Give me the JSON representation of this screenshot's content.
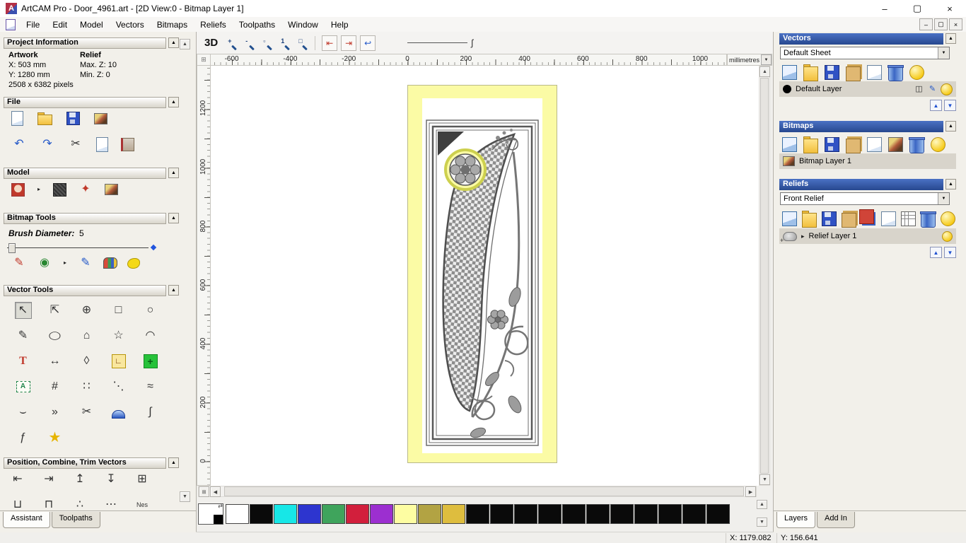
{
  "window": {
    "title": "ArtCAM Pro - Door_4961.art - [2D View:0 - Bitmap Layer 1]",
    "logo": "A",
    "controls": {
      "minimize": "–",
      "maximize": "▢",
      "close": "×"
    },
    "menu_items": [
      {
        "label": "File"
      },
      {
        "label": "Edit"
      },
      {
        "label": "Model"
      },
      {
        "label": "Vectors"
      },
      {
        "label": "Bitmaps"
      },
      {
        "label": "Reliefs"
      },
      {
        "label": "Toolpaths"
      },
      {
        "label": "Window"
      },
      {
        "label": "Help"
      }
    ]
  },
  "ui": {
    "collapse": "▲",
    "up": "▲",
    "down": "▼",
    "left": "◀",
    "right": "▶",
    "dropdown": "▼",
    "expander": "▸",
    "swap": "⇄",
    "corner": "⊞"
  },
  "toolbar": {
    "curve_glyph": "ʃ",
    "icons": [
      {
        "n": "view-3d",
        "g": "3D",
        "c": "btn-3d"
      },
      {
        "n": "zoom-in",
        "g": "+",
        "c": "shape-mag"
      },
      {
        "n": "zoom-out",
        "g": "-",
        "c": "shape-mag"
      },
      {
        "n": "zoom-window",
        "g": "▫",
        "c": "shape-mag"
      },
      {
        "n": "zoom-100",
        "g": "1",
        "c": "shape-mag"
      },
      {
        "n": "zoom-fit",
        "g": "□",
        "c": "shape-mag"
      },
      {
        "n": "separator",
        "c": "toolbar-sep",
        "x": false
      },
      {
        "n": "snapshot-left",
        "g": "⇤",
        "c": "boxed glyph-red"
      },
      {
        "n": "snapshot-right",
        "g": "⇥",
        "c": "boxed glyph-red"
      },
      {
        "n": "previous-view",
        "g": "↩",
        "c": "boxed glyph-blue"
      }
    ]
  },
  "rulers": {
    "horizontal_labels": [
      "-600",
      "-400",
      "-200",
      "0",
      "200",
      "400",
      "600",
      "800",
      "1000"
    ],
    "vertical_labels": [
      "1200",
      "1000",
      "800",
      "600",
      "400",
      "200",
      "0"
    ],
    "units": "millimetres"
  },
  "assistant": {
    "project_information": {
      "title": "Project Information",
      "artwork_heading": "Artwork",
      "relief_heading": "Relief",
      "artwork_x": "X: 503 mm",
      "artwork_y": "Y: 1280 mm",
      "relief_max_z": "Max. Z: 10",
      "relief_min_z": "Min. Z: 0",
      "pixels": "2508 x 6382 pixels"
    },
    "file_section_title": "File",
    "model_section_title": "Model",
    "bitmap_tools_title": "Bitmap Tools",
    "brush_diameter_label": "Brush Diameter:",
    "brush_diameter_value": "5",
    "vector_tools_title": "Vector Tools",
    "position_section_title": "Position, Combine, Trim Vectors",
    "file_row1": [
      {
        "n": "new-model",
        "c": "shape-page"
      },
      {
        "n": "open-model",
        "c": "shape-folder"
      },
      {
        "n": "save-model",
        "c": "shape-save"
      },
      {
        "n": "model-preview",
        "c": "shape-img"
      }
    ],
    "file_row2": [
      {
        "n": "undo",
        "g": "↶",
        "c": "glyph-blue"
      },
      {
        "n": "redo",
        "g": "↷",
        "c": "glyph-blue"
      },
      {
        "n": "cut",
        "g": "✂",
        "c": "glyph-dark"
      },
      {
        "n": "paste",
        "c": "shape-page"
      },
      {
        "n": "notes",
        "c": "shape-book"
      }
    ],
    "model_row": [
      {
        "n": "model-lighting",
        "c": "shape-face"
      },
      {
        "n": "flyout",
        "g": "▸",
        "c": "flyout",
        "x": false
      },
      {
        "n": "model-texture",
        "c": "shape-tex"
      },
      {
        "n": "model-stamp",
        "g": "✦",
        "c": "glyph-red"
      },
      {
        "n": "model-image",
        "c": "shape-img"
      }
    ],
    "bitmap_row": [
      {
        "n": "paint-brush",
        "g": "✎",
        "c": "glyph-red"
      },
      {
        "n": "flood-fill",
        "g": "◉",
        "c": "glyph-green"
      },
      {
        "n": "flyout",
        "g": "▸",
        "c": "flyout",
        "x": false
      },
      {
        "n": "paint-selective",
        "g": "✎",
        "c": "glyph-blue"
      },
      {
        "n": "colour-palette",
        "c": "shape-palette"
      },
      {
        "n": "magic-texture",
        "c": "shape-blob"
      }
    ],
    "vector_tools_icons": [
      {
        "n": "select-vectors",
        "g": "↖",
        "c": "pressed glyph-dark"
      },
      {
        "n": "transform-vectors",
        "g": "⇱",
        "c": "glyph-dark"
      },
      {
        "n": "move-vectors",
        "g": "⊕",
        "c": "glyph-dark"
      },
      {
        "n": "create-rectangle",
        "g": "□",
        "c": "glyph-dark"
      },
      {
        "n": "create-circle",
        "g": "○",
        "c": "glyph-dark"
      },
      {
        "n": "create-polyline",
        "g": "✎",
        "c": "glyph-dark"
      },
      {
        "n": "create-ellipse",
        "g": "◯",
        "c": "glyph-dark glyph-ellipse"
      },
      {
        "n": "create-polygon",
        "g": "⌂",
        "c": "glyph-dark"
      },
      {
        "n": "create-star",
        "g": "☆",
        "c": "glyph-dark"
      },
      {
        "n": "create-arc",
        "g": "◠",
        "c": "glyph-dark"
      },
      {
        "n": "create-text",
        "g": "T",
        "c": "glyph-text"
      },
      {
        "n": "measure",
        "g": "↔",
        "c": "glyph-dark"
      },
      {
        "n": "offset-vector",
        "g": "◊",
        "c": "glyph-dark"
      },
      {
        "n": "fillet-tool",
        "g": "∟",
        "c": "shape-fillet"
      },
      {
        "n": "paste-along-curve",
        "g": "+",
        "c": "shape-greencross"
      },
      {
        "n": "text-block",
        "g": "A",
        "c": "shape-abc"
      },
      {
        "n": "make-grid",
        "g": "#",
        "c": "glyph-dark"
      },
      {
        "n": "block-copy",
        "g": "∷",
        "c": "glyph-dark"
      },
      {
        "n": "node-editing",
        "g": "⋱",
        "c": "glyph-dark"
      },
      {
        "n": "fit-polyline",
        "g": "≈",
        "c": "glyph-dark"
      },
      {
        "n": "fit-arcs",
        "g": "⌣",
        "c": "glyph-dark"
      },
      {
        "n": "join-vectors",
        "g": "»",
        "c": "glyph-dark"
      },
      {
        "n": "trim-vectors",
        "g": "✂",
        "c": "glyph-dark"
      },
      {
        "n": "create-dome",
        "c": "shape-dome"
      },
      {
        "n": "fit-spline",
        "g": "∫",
        "c": "glyph-dark"
      },
      {
        "n": "wrap-text",
        "g": "ƒ",
        "c": "glyph-dark"
      },
      {
        "n": "star-wizard",
        "g": "★",
        "c": "glyph-gold"
      }
    ],
    "position_row1": [
      {
        "n": "align-left",
        "g": "⇤",
        "c": "glyph-dark"
      },
      {
        "n": "align-right",
        "g": "⇥",
        "c": "glyph-dark"
      },
      {
        "n": "align-top",
        "g": "↥",
        "c": "glyph-dark"
      },
      {
        "n": "align-bottom",
        "g": "↧",
        "c": "glyph-dark"
      },
      {
        "n": "align-centre",
        "g": "⊞",
        "c": "glyph-dark"
      }
    ],
    "position_row2": [
      {
        "n": "weld-vectors",
        "g": "⊔",
        "c": "glyph-dark"
      },
      {
        "n": "subtract-vectors",
        "g": "⊓",
        "c": "glyph-dark"
      },
      {
        "n": "slice-vectors",
        "g": "∴",
        "c": "glyph-dark"
      },
      {
        "n": "scatter-vectors",
        "g": "⋯",
        "c": "glyph-dark"
      },
      {
        "n": "nest-vectors",
        "g": "Nes",
        "c": "glyph-tiny"
      }
    ],
    "tabs": [
      {
        "label": "Assistant",
        "active": true
      },
      {
        "label": "Toolpaths",
        "active": false
      }
    ]
  },
  "layers_panel": {
    "vectors": {
      "title": "Vectors",
      "sheet_selector": "Default Sheet",
      "layer_name": "Default Layer",
      "toolbar": [
        {
          "n": "new-vector-layer",
          "c": "shape-page-blue"
        },
        {
          "n": "open-vector-layer",
          "c": "shape-folder"
        },
        {
          "n": "save-vector-layer",
          "c": "shape-save"
        },
        {
          "n": "merge-vector-layers",
          "c": "shape-stack"
        },
        {
          "n": "copy-vector-layer",
          "c": "shape-page"
        },
        {
          "n": "delete-vector-layer",
          "c": "shape-trash"
        },
        {
          "n": "toggle-all-vectors",
          "c": "shape-bulb"
        }
      ],
      "layer_controls": [
        {
          "n": "layer-snap",
          "g": "◫",
          "c": "glyph-dark"
        },
        {
          "n": "layer-edit",
          "g": "✎",
          "c": "glyph-blue"
        },
        {
          "n": "layer-visibility",
          "c": "shape-bulb"
        }
      ]
    },
    "bitmaps": {
      "title": "Bitmaps",
      "layer_name": "Bitmap Layer 1",
      "toolbar": [
        {
          "n": "new-bitmap-layer",
          "c": "shape-page-blue"
        },
        {
          "n": "open-bitmap-layer",
          "c": "shape-folder"
        },
        {
          "n": "save-bitmap-layer",
          "c": "shape-save"
        },
        {
          "n": "merge-bitmap-layers",
          "c": "shape-stack"
        },
        {
          "n": "copy-bitmap-layer",
          "c": "shape-page"
        },
        {
          "n": "colour-reduce",
          "c": "shape-img"
        },
        {
          "n": "delete-bitmap-layer",
          "c": "shape-trash"
        },
        {
          "n": "toggle-all-bitmaps",
          "c": "shape-bulb"
        }
      ]
    },
    "reliefs": {
      "title": "Reliefs",
      "relief_selector": "Front Relief",
      "layer_name": "Relief Layer 1",
      "toolbar": [
        {
          "n": "new-relief-layer",
          "c": "shape-page-blue"
        },
        {
          "n": "open-relief-layer",
          "c": "shape-folder"
        },
        {
          "n": "save-relief-layer",
          "c": "shape-save"
        },
        {
          "n": "merge-relief-layers",
          "c": "shape-stack"
        },
        {
          "n": "relief-layer-stack",
          "c": "shape-layers"
        },
        {
          "n": "copy-relief-layer",
          "c": "shape-page"
        },
        {
          "n": "relief-calculate",
          "c": "shape-grid"
        },
        {
          "n": "delete-relief-layer",
          "c": "shape-trash"
        },
        {
          "n": "toggle-all-reliefs",
          "c": "shape-bulb"
        }
      ]
    },
    "tabs": [
      {
        "label": "Layers",
        "active": true
      },
      {
        "label": "Add In",
        "active": false
      }
    ]
  },
  "palette": {
    "colors": [
      "#ffffff",
      "#0a0a0a",
      "#17e7e7",
      "#2d35cf",
      "#3fa45c",
      "#d21f3c",
      "#9c2fd0",
      "#fdfda2",
      "#b2a343",
      "#debd3e",
      "#0a0a0a",
      "#0a0a0a",
      "#0a0a0a",
      "#0a0a0a",
      "#0a0a0a",
      "#0a0a0a",
      "#0a0a0a",
      "#0a0a0a",
      "#0a0a0a",
      "#0a0a0a",
      "#0a0a0a"
    ]
  },
  "status_bar": {
    "x": "X: 1179.082",
    "y": "Y: 156.641"
  }
}
